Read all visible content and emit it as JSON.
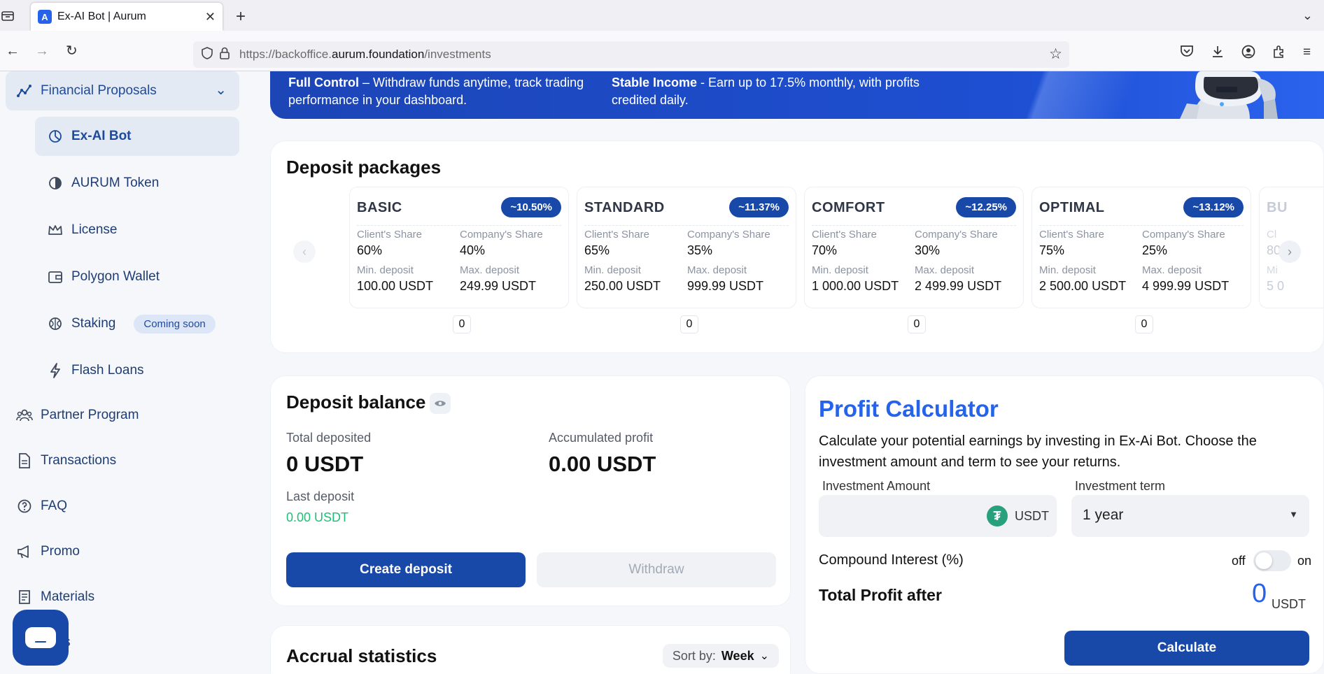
{
  "browser": {
    "tab_title": "Ex-AI Bot | Aurum",
    "url_prefix": "https://backoffice.",
    "url_host": "aurum.foundation",
    "url_path": "/investments"
  },
  "sidebar": {
    "financial_proposals": "Financial Proposals",
    "sub_items": [
      {
        "label": "Ex-AI Bot"
      },
      {
        "label": "AURUM Token"
      },
      {
        "label": "License"
      },
      {
        "label": "Polygon Wallet"
      },
      {
        "label": "Staking",
        "badge": "Coming soon"
      },
      {
        "label": "Flash Loans"
      }
    ],
    "top_items": [
      {
        "label": "Partner Program"
      },
      {
        "label": "Transactions"
      },
      {
        "label": "FAQ"
      },
      {
        "label": "Promo"
      },
      {
        "label": "Materials"
      },
      {
        "label": "ngs"
      }
    ]
  },
  "banner": {
    "full_control_title": "Full Control",
    "full_control_text": " – Withdraw funds anytime, track trading",
    "full_control_text2": "performance in your dashboard.",
    "stable_income_title": "Stable Income",
    "stable_income_text": " - Earn up to 17.5% monthly, with profits",
    "stable_income_text2": "credited daily."
  },
  "packages": {
    "title": "Deposit packages",
    "labels": {
      "client_share": "Client's Share",
      "company_share": "Company's Share",
      "min_deposit": "Min. deposit",
      "max_deposit": "Max. deposit"
    },
    "items": [
      {
        "name": "BASIC",
        "rate": "~10.50%",
        "client": "60%",
        "company": "40%",
        "min": "100.00 USDT",
        "max": "249.99 USDT",
        "count": "0"
      },
      {
        "name": "STANDARD",
        "rate": "~11.37%",
        "client": "65%",
        "company": "35%",
        "min": "250.00 USDT",
        "max": "999.99 USDT",
        "count": "0"
      },
      {
        "name": "COMFORT",
        "rate": "~12.25%",
        "client": "70%",
        "company": "30%",
        "min": "1 000.00 USDT",
        "max": "2 499.99 USDT",
        "count": "0"
      },
      {
        "name": "OPTIMAL",
        "rate": "~13.12%",
        "client": "75%",
        "company": "25%",
        "min": "2 500.00 USDT",
        "max": "4 999.99 USDT",
        "count": "0"
      }
    ],
    "partial": {
      "name": "BU",
      "client_lbl": "Cl",
      "client": "80",
      "min_lbl": "Mi",
      "min": "5 0"
    }
  },
  "balance": {
    "title": "Deposit balance",
    "total_deposited_label": "Total deposited",
    "total_deposited": "0 USDT",
    "accumulated_label": "Accumulated profit",
    "accumulated": "0.00 USDT",
    "last_deposit_label": "Last deposit",
    "last_deposit": "0.00 USDT",
    "create_btn": "Create deposit",
    "withdraw_btn": "Withdraw"
  },
  "calculator": {
    "title": "Profit Calculator",
    "description": "Calculate your potential earnings by investing in Ex-Ai Bot. Choose the investment amount and term to see your returns.",
    "amount_label": "Investment Amount",
    "amount_value": "",
    "amount_currency": "USDT",
    "term_label": "Investment term",
    "term_value": "1 year",
    "compound_label": "Compound Interest (%)",
    "toggle_off": "off",
    "toggle_on": "on",
    "compound_enabled": false,
    "total_label": "Total Profit after",
    "total_value": "0",
    "total_currency": "USDT",
    "calculate_btn": "Calculate"
  },
  "accrual": {
    "title": "Accrual statistics",
    "sort_label": "Sort by:",
    "sort_value": "Week"
  },
  "colors": {
    "primary": "#1849a9",
    "accent_blue": "#2563eb",
    "green": "#1fbf73"
  }
}
